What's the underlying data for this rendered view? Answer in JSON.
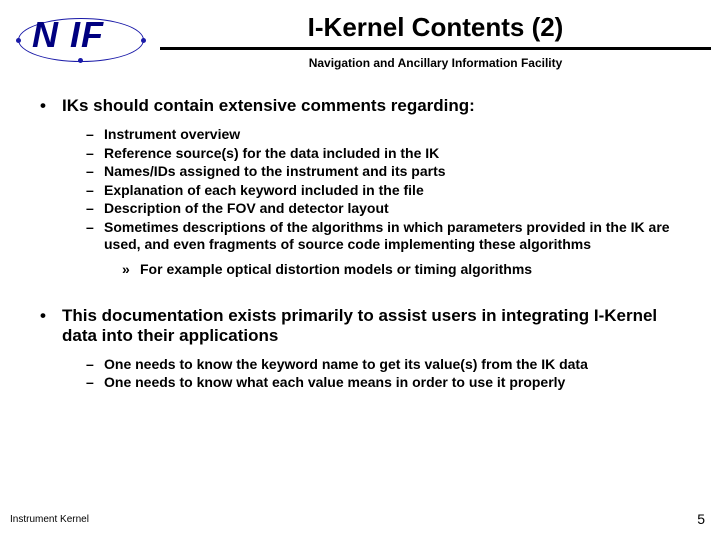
{
  "logo": {
    "text": "N IF"
  },
  "header": {
    "title": "I-Kernel Contents (2)",
    "subtitle": "Navigation and Ancillary Information Facility"
  },
  "section1": {
    "lead": "IKs should contain extensive comments regarding:",
    "items": [
      "Instrument overview",
      "Reference source(s) for the data included in the IK",
      "Names/IDs assigned to the instrument and its parts",
      "Explanation of each keyword included in the file",
      "Description of the FOV and detector layout",
      "Sometimes descriptions of the algorithms in which parameters provided in the IK are used, and even fragments of source code implementing these algorithms"
    ],
    "sub": "For example optical distortion models or timing algorithms"
  },
  "section2": {
    "lead": "This documentation exists primarily to assist users in integrating I-Kernel data into their applications",
    "items": [
      "One needs to know the keyword name to get its value(s) from the IK data",
      "One needs to know what each value means in order to use it properly"
    ]
  },
  "footer": {
    "left": "Instrument Kernel",
    "right": "5"
  }
}
